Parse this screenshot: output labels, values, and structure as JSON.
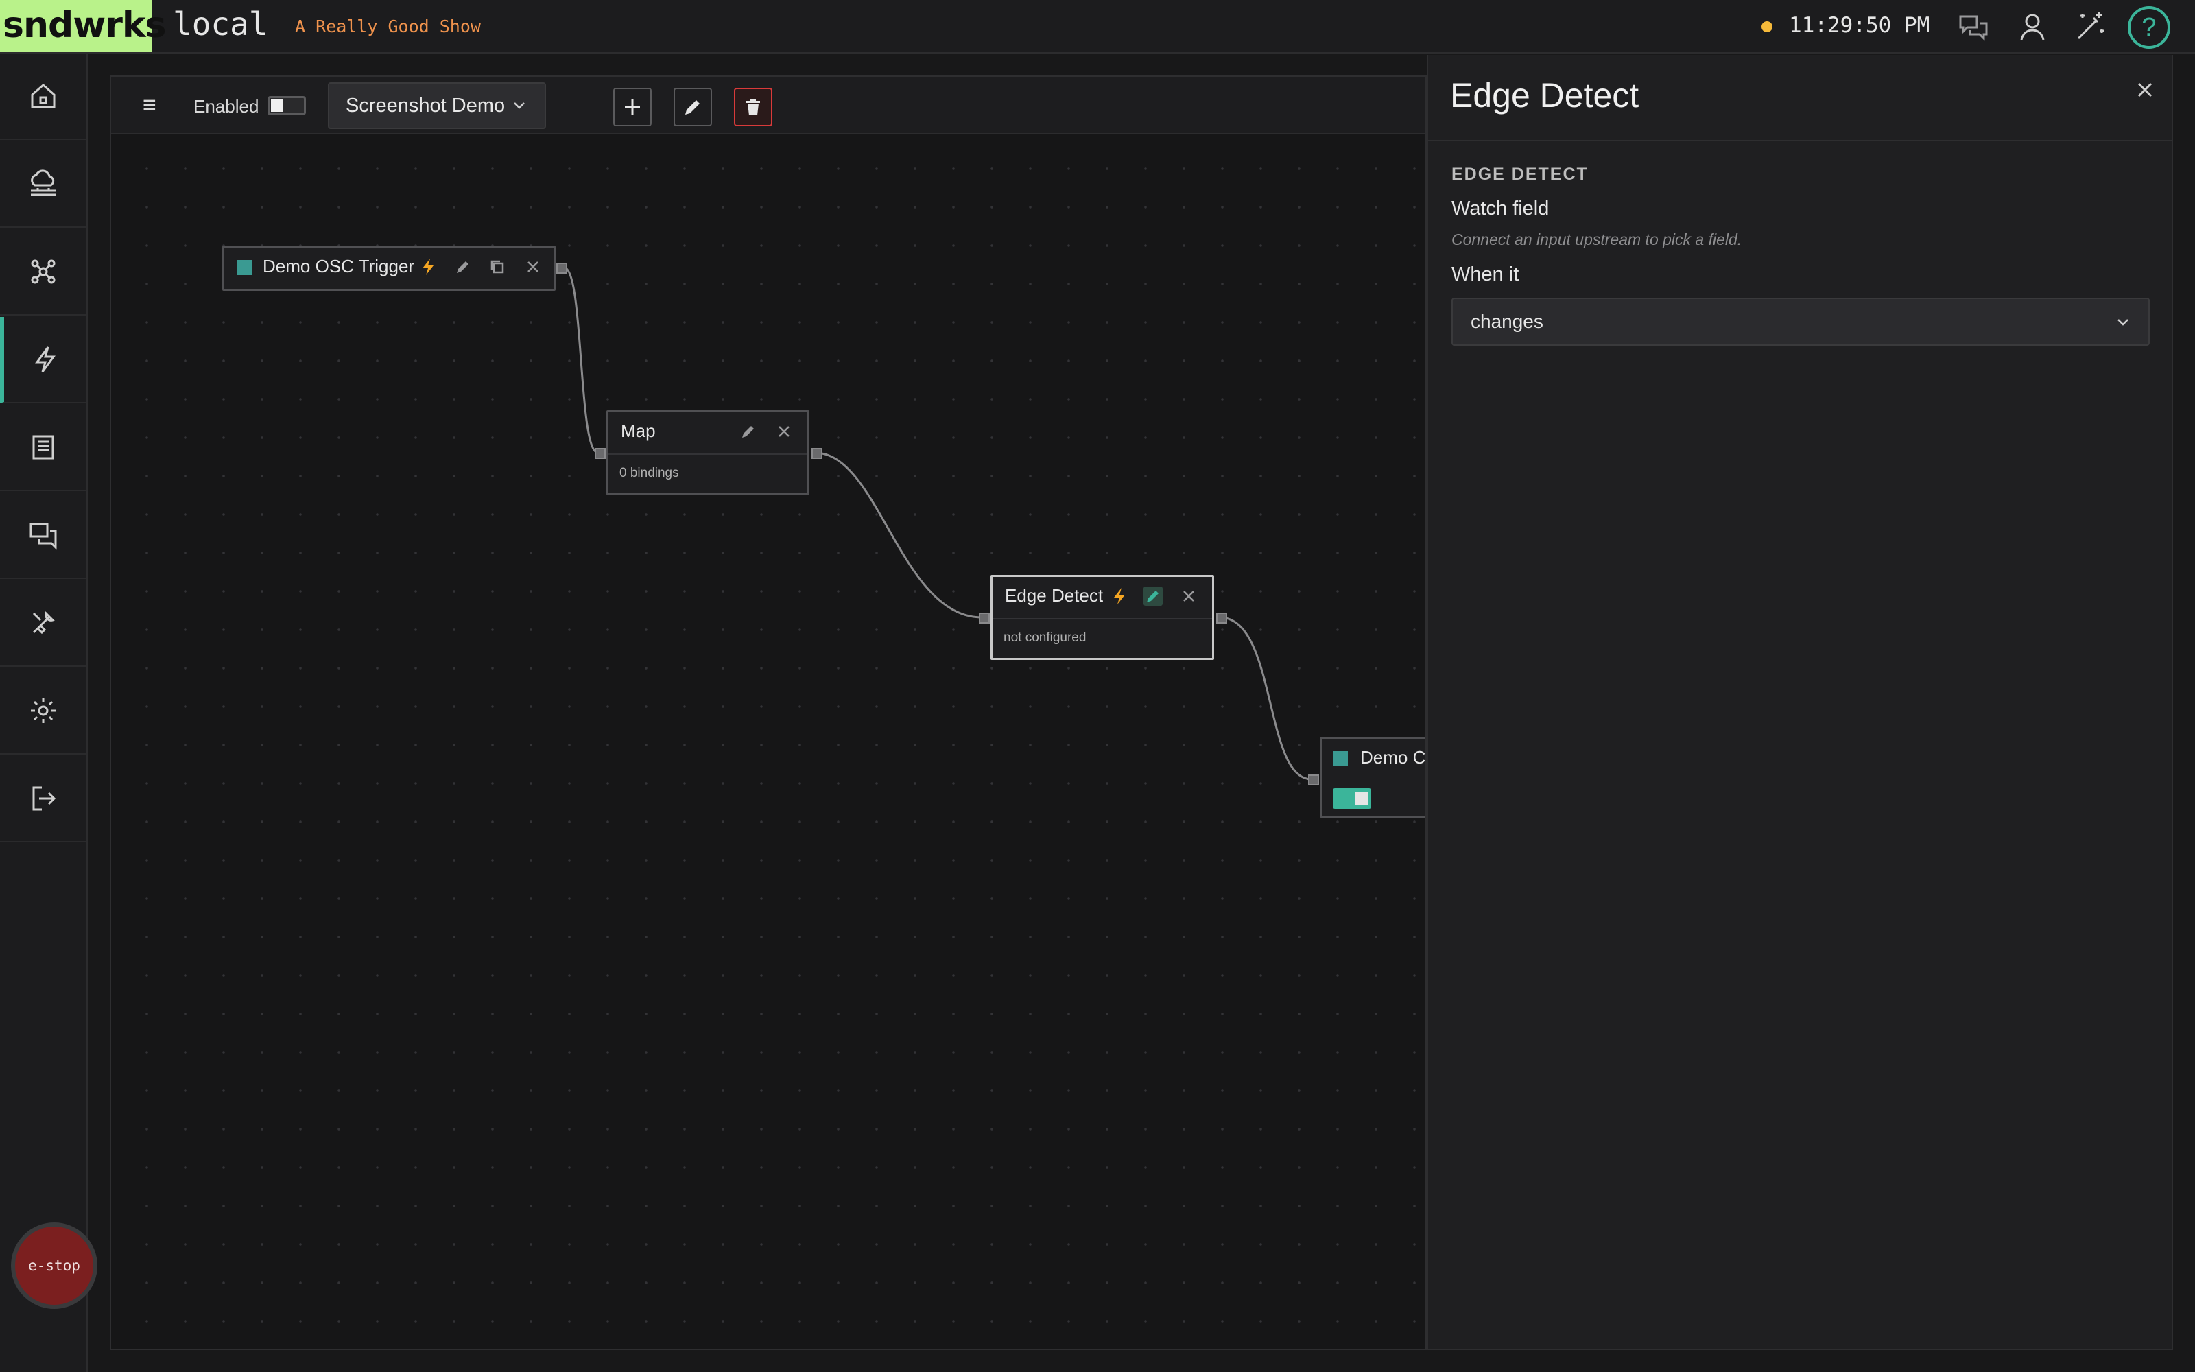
{
  "app": {
    "logo": "sndwrks",
    "environment": "local",
    "show_name": "A Really Good Show",
    "clock": "11:29:50 PM",
    "status_color": "#f5b93a",
    "accent_color": "#3bb59a",
    "logo_color": "#b9f28a"
  },
  "header_icons": [
    "chat-icon",
    "user-icon",
    "magic-wand-icon",
    "help-icon"
  ],
  "help_glyph": "?",
  "sidebar": {
    "items": [
      {
        "name": "home-icon",
        "active": false
      },
      {
        "name": "cloud-network-icon",
        "active": false
      },
      {
        "name": "graph-icon",
        "active": false
      },
      {
        "name": "lightning-icon",
        "active": true
      },
      {
        "name": "document-icon",
        "active": false
      },
      {
        "name": "chat-screens-icon",
        "active": false
      },
      {
        "name": "tools-icon",
        "active": false
      },
      {
        "name": "gear-icon",
        "active": false
      },
      {
        "name": "logout-icon",
        "active": false
      }
    ],
    "estop_label": "e-stop"
  },
  "toolbar": {
    "menu_glyph": "≡",
    "enabled_label": "Enabled",
    "enabled": false,
    "flow_name": "Screenshot Demo",
    "buttons": [
      "add-icon",
      "pencil-icon",
      "trash-icon"
    ]
  },
  "nodes": [
    {
      "id": "demo-osc-trigger",
      "title": "Demo OSC Trigger",
      "subtitle": ""
    },
    {
      "id": "map",
      "title": "Map",
      "subtitle": "0 bindings"
    },
    {
      "id": "edge-detect",
      "title": "Edge Detect",
      "subtitle": "not configured"
    },
    {
      "id": "demo-co",
      "title": "Demo Co",
      "subtitle": ""
    }
  ],
  "panel": {
    "title": "Edge Detect",
    "section_heading": "EDGE DETECT",
    "watch_field_label": "Watch field",
    "watch_field_help": "Connect an input upstream to pick a field.",
    "when_label": "When it",
    "when_value": "changes"
  }
}
